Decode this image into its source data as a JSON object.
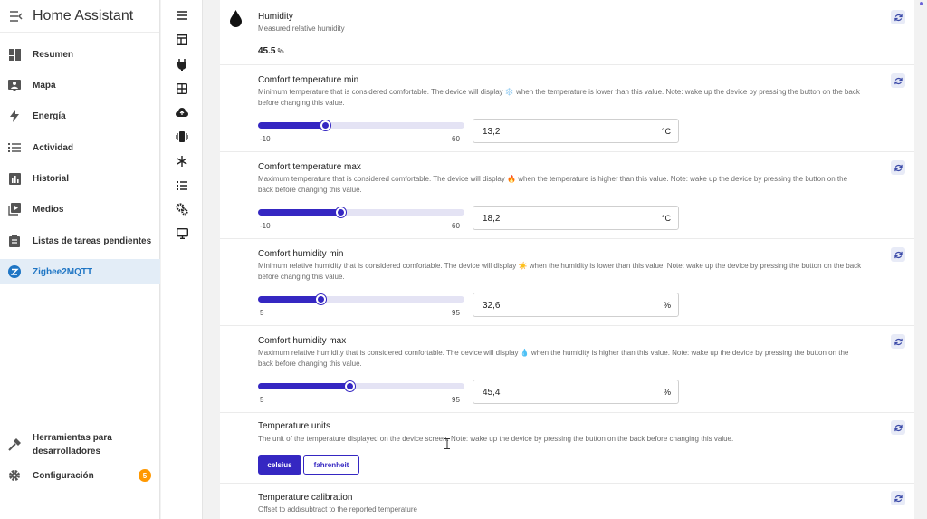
{
  "sidebar": {
    "title": "Home Assistant",
    "items": [
      {
        "label": "Resumen"
      },
      {
        "label": "Mapa"
      },
      {
        "label": "Energía"
      },
      {
        "label": "Actividad"
      },
      {
        "label": "Historial"
      },
      {
        "label": "Medios"
      },
      {
        "label": "Listas de tareas pendientes"
      },
      {
        "label": "Zigbee2MQTT"
      }
    ],
    "dev_tools_line1": "Herramientas para",
    "dev_tools_line2": "desarrolladores",
    "settings_label": "Configuración",
    "settings_badge": "5",
    "active_color": "#1e75c4"
  },
  "toolbar": {
    "icons": [
      "menu-icon",
      "dashboard-icon",
      "plug-icon",
      "grid-icon",
      "cloud-upload-icon",
      "vibrate-icon",
      "snowflake-icon",
      "list-icon",
      "cogs-icon",
      "monitor-icon"
    ]
  },
  "humidity": {
    "title": "Humidity",
    "desc": "Measured relative humidity",
    "value": "45.5",
    "unit": "%"
  },
  "settings": [
    {
      "title": "Comfort temperature min",
      "desc": "Minimum temperature that is considered comfortable. The device will display ❄️ when the temperature is lower than this value. Note: wake up the device by pressing the button on the back before changing this value.",
      "min": "-10",
      "max": "60",
      "value": "13,2",
      "unit": "°C",
      "fill": 0.331
    },
    {
      "title": "Comfort temperature max",
      "desc": "Maximum temperature that is considered comfortable. The device will display 🔥 when the temperature is higher than this value. Note: wake up the device by pressing the button on the back before changing this value.",
      "min": "-10",
      "max": "60",
      "value": "18,2",
      "unit": "°C",
      "fill": 0.403
    },
    {
      "title": "Comfort humidity min",
      "desc": "Minimum relative humidity that is considered comfortable. The device will display ☀️ when the humidity is lower than this value. Note: wake up the device by pressing the button on the back before changing this value.",
      "min": "5",
      "max": "95",
      "value": "32,6",
      "unit": "%",
      "fill": 0.307
    },
    {
      "title": "Comfort humidity max",
      "desc": "Maximum relative humidity that is considered comfortable. The device will display 💧 when the humidity is higher than this value. Note: wake up the device by pressing the button on the back before changing this value.",
      "min": "5",
      "max": "95",
      "value": "45,4",
      "unit": "%",
      "fill": 0.449
    }
  ],
  "units": {
    "title": "Temperature units",
    "desc": "The unit of the temperature displayed on the device screen. Note: wake up the device by pressing the button on the back before changing this value.",
    "options": [
      "celsius",
      "fahrenheit"
    ],
    "selected": "celsius"
  },
  "calibration": {
    "title": "Temperature calibration",
    "desc": "Offset to add/subtract to the reported temperature"
  },
  "colors": {
    "accent": "#3527c2",
    "badge": "#ff9800"
  }
}
